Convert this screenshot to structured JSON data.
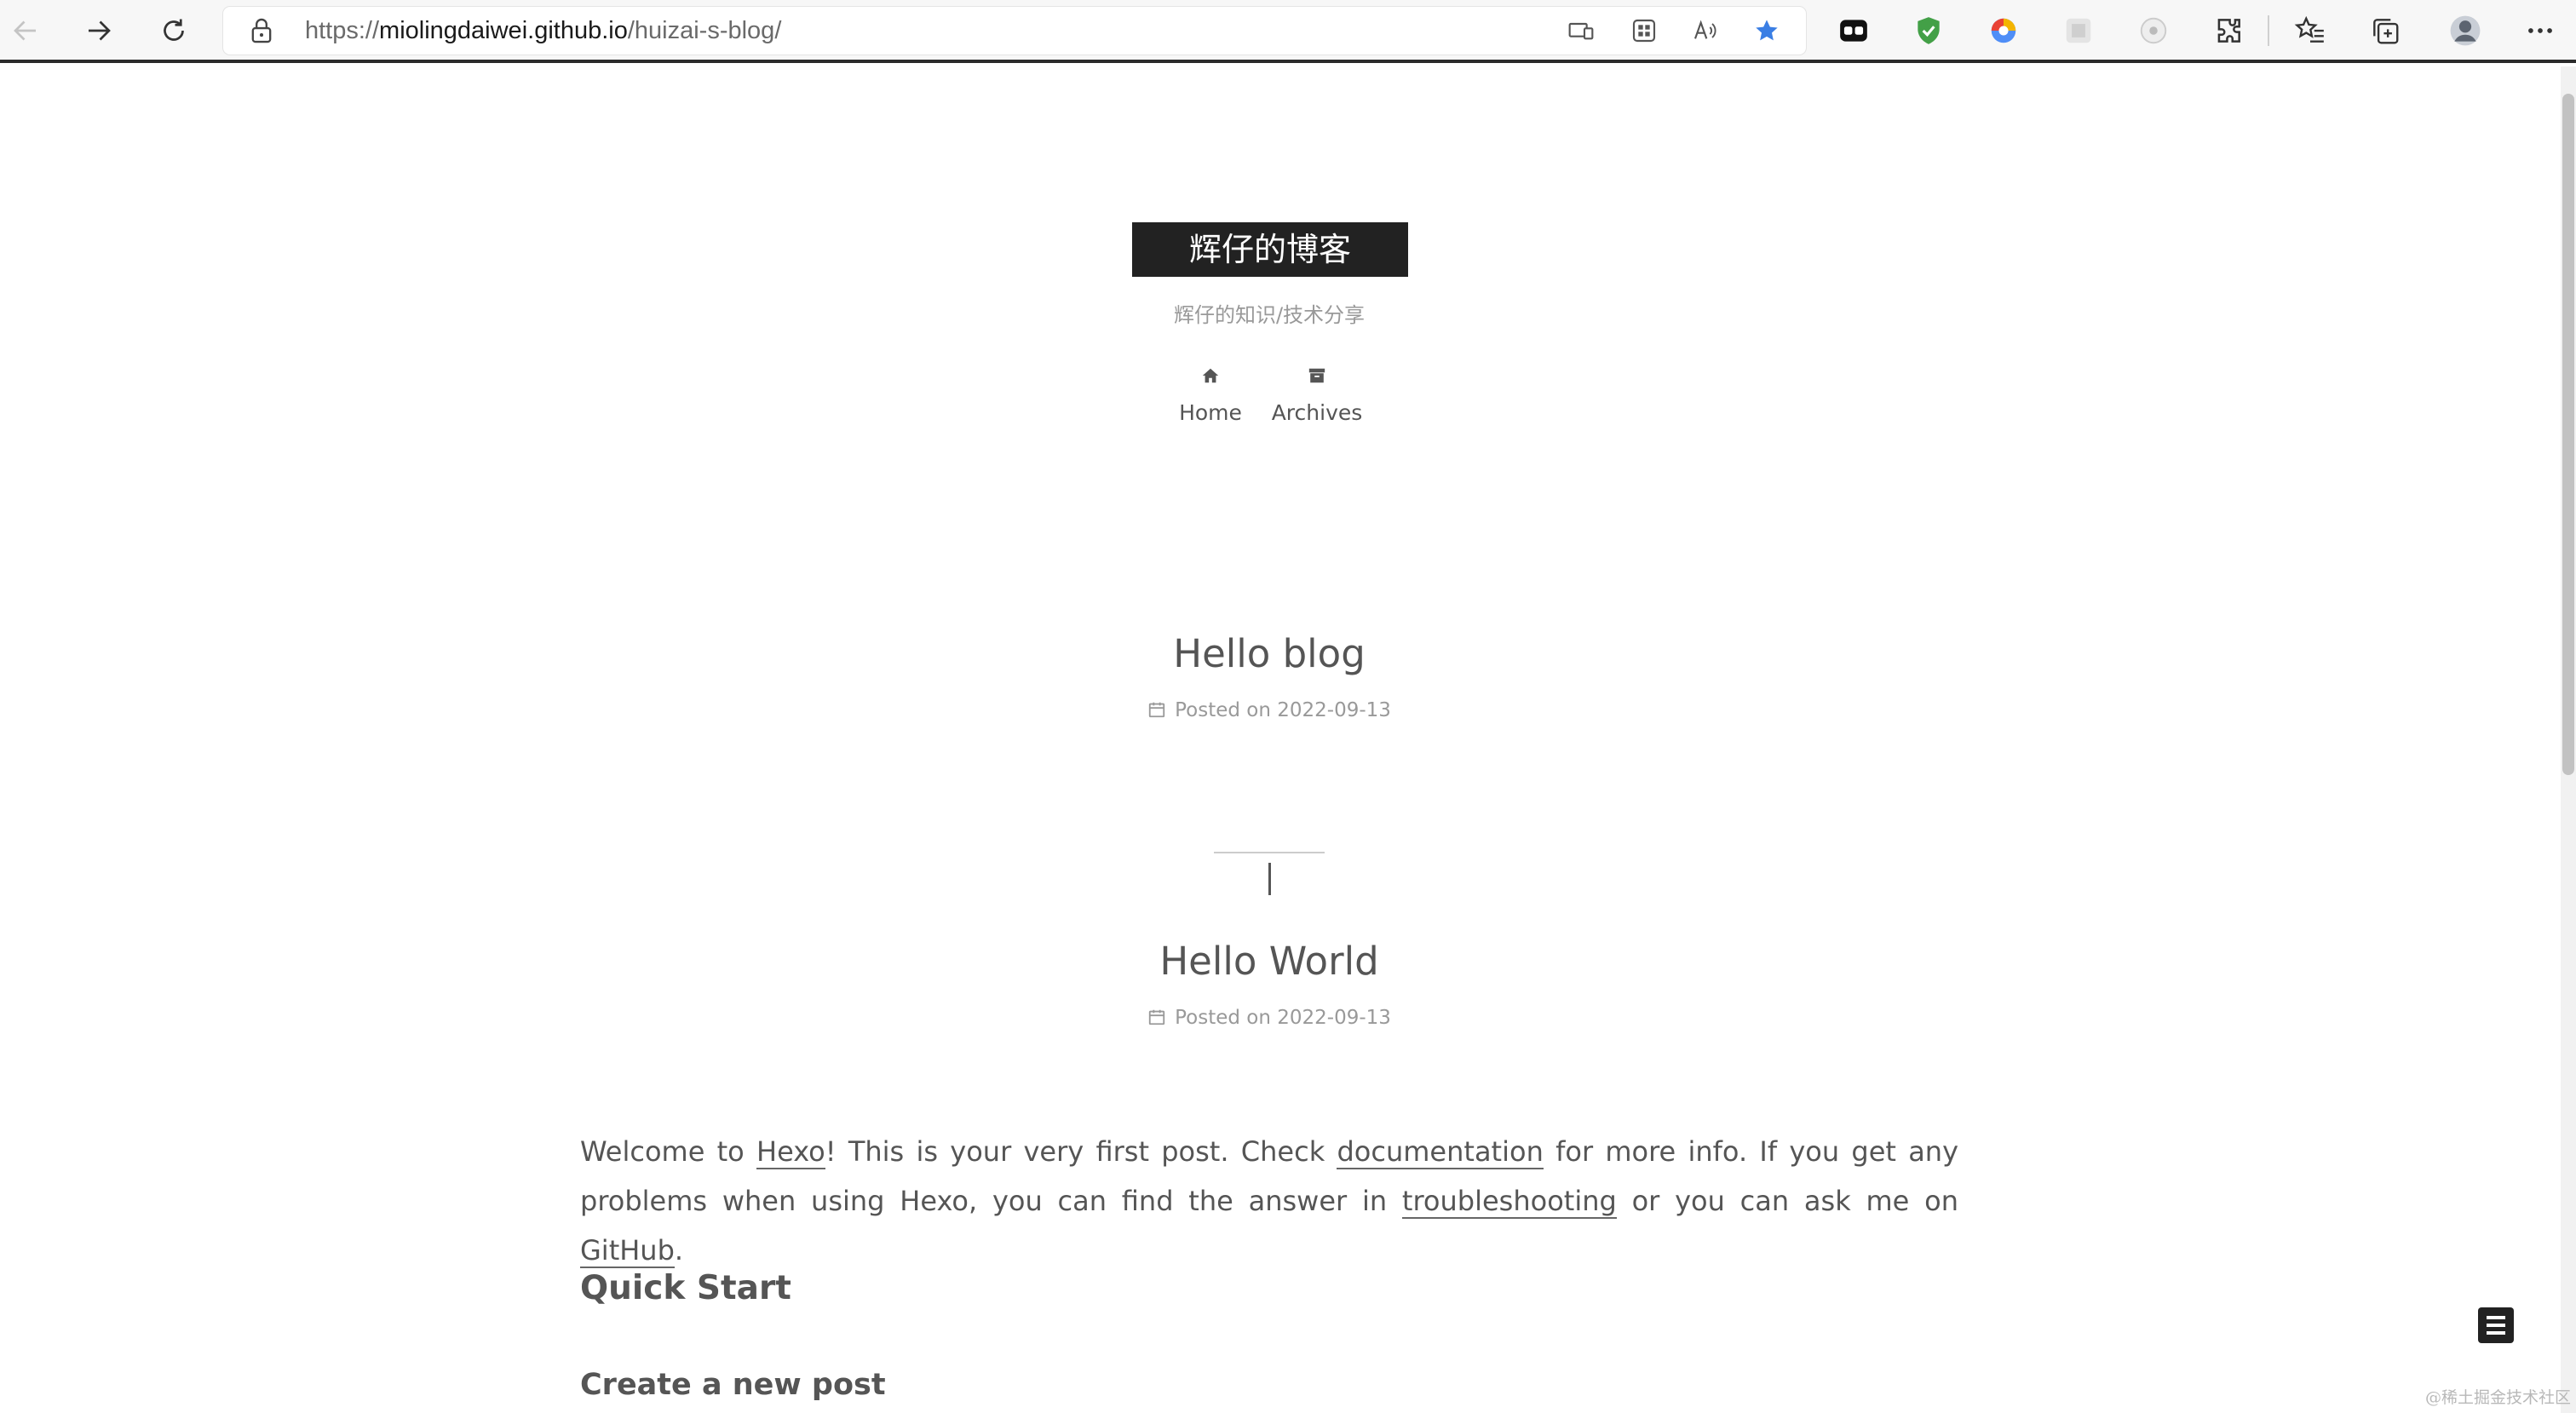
{
  "browser": {
    "url_prefix": "https://",
    "url_host": "miolingdaiwei.github.io",
    "url_path": "/huizai-s-blog/",
    "icons": [
      "back-icon",
      "forward-icon",
      "refresh-icon",
      "lock-icon",
      "device-icon",
      "qr-icon",
      "read-aloud-icon",
      "favorite-star-icon",
      "extension-icon",
      "shield-icon",
      "globe-icon",
      "grid-icon",
      "circle-icon",
      "puzzle-icon",
      "favorites-icon",
      "collections-icon",
      "avatar",
      "more-icon"
    ],
    "accent_color": "#3a7ee4"
  },
  "site": {
    "brand": "辉仔的博客",
    "subtitle": "辉仔的知识/技术分享",
    "menu": [
      {
        "label": "Home",
        "icon": "home-icon"
      },
      {
        "label": "Archives",
        "icon": "archive-icon"
      }
    ]
  },
  "posts": [
    {
      "title": "Hello blog",
      "meta": "Posted on 2022-09-13"
    },
    {
      "title": "Hello World",
      "meta": "Posted on 2022-09-13"
    }
  ],
  "body": {
    "p1": "Welcome to ",
    "link_hexo": "Hexo",
    "p2": "! This is your very first post. Check ",
    "link_docs": "documentation",
    "p3": " for more info. If you get any problems when using Hexo, you can find the answer in ",
    "link_trouble": "troubleshooting",
    "p4": " or you can ask me on ",
    "link_github": "GitHub",
    "p5": ".",
    "h_quick": "Quick Start",
    "h_create": "Create a new post"
  },
  "watermark": "@稀土掘金技术社区"
}
